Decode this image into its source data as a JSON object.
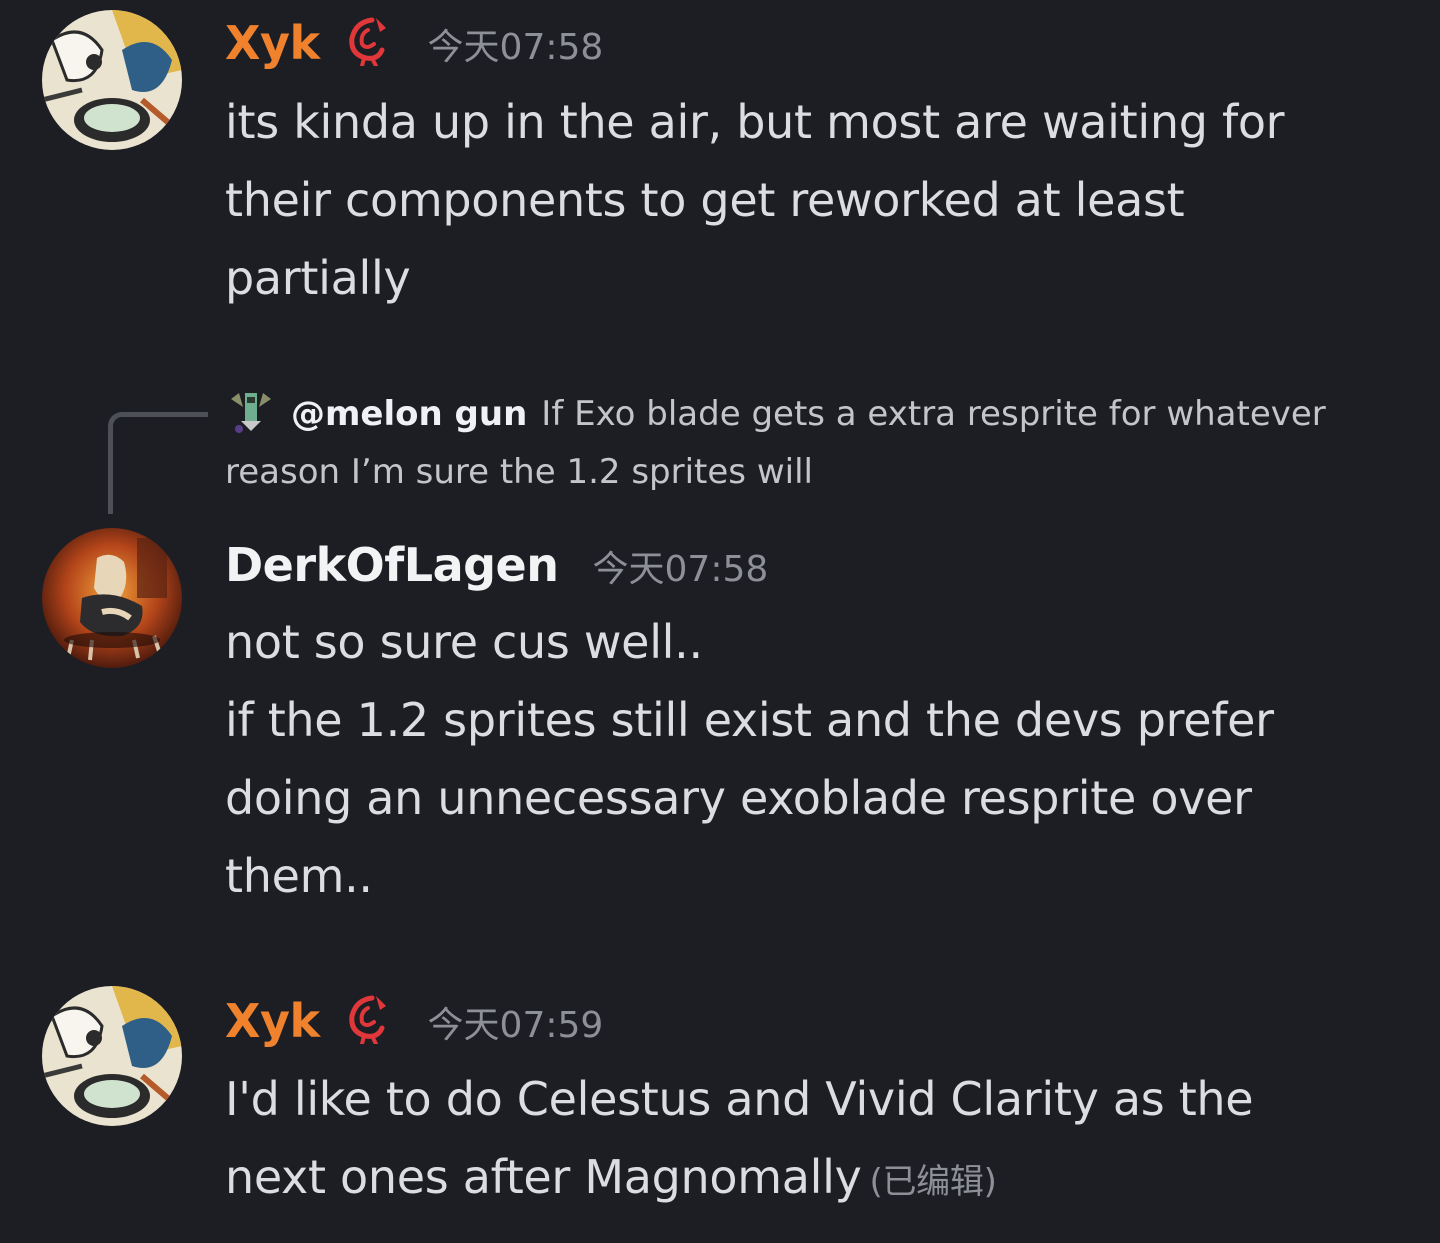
{
  "messages": [
    {
      "username": "Xyk",
      "username_color": "#f0822d",
      "timestamp": "今天07:58",
      "avatar": "xyk-avatar",
      "role_icon": "red-swirl-role-icon",
      "lines": [
        "its kinda up in the air, but most are waiting for",
        "their components to get reworked at least",
        "partially"
      ]
    },
    {
      "reply": {
        "avatar": "melon-gun-avatar",
        "name": "@melon gun",
        "text_line1": "If Exo blade gets a extra resprite for whatever",
        "text_line2": "reason I’m sure the 1.2 sprites will"
      },
      "username": "DerkOfLagen",
      "username_color": "#f2f3f5",
      "timestamp": "今天07:58",
      "avatar": "derkoflagen-avatar",
      "lines": [
        "not so sure cus well..",
        "if the 1.2 sprites still exist and the devs prefer",
        "doing an unnecessary exoblade resprite over",
        "them.."
      ]
    },
    {
      "username": "Xyk",
      "username_color": "#f0822d",
      "timestamp": "今天07:59",
      "avatar": "xyk-avatar",
      "role_icon": "red-swirl-role-icon",
      "lines": [
        "I'd like to do Celestus and Vivid Clarity as the",
        "next ones after Magnomally"
      ],
      "edited_label": "(已编辑)"
    }
  ]
}
